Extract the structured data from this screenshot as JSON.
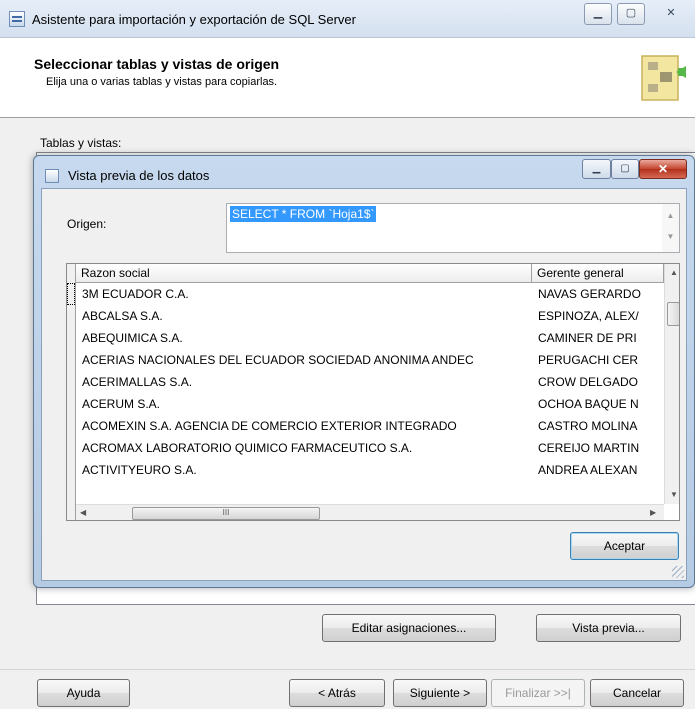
{
  "window": {
    "title": "Asistente para importación y exportación de SQL Server",
    "minimize_glyph": "▁",
    "maximize_glyph": "▢",
    "close_glyph": "✕"
  },
  "header": {
    "title": "Seleccionar tablas y vistas de origen",
    "subtitle": "Elija una o varias tablas y vistas para copiarlas."
  },
  "tables_label": "Tablas y vistas:",
  "preview_dialog": {
    "title": "Vista previa de los datos",
    "origin_label": "Origen:",
    "sql": "SELECT * FROM `Hoja1$`",
    "columns": [
      "Razon social",
      "Gerente general"
    ],
    "rows": [
      [
        "3M ECUADOR C.A.",
        "NAVAS GERARDO"
      ],
      [
        "ABCALSA S.A.",
        "ESPINOZA, ALEX/"
      ],
      [
        "ABEQUIMICA S.A.",
        "CAMINER DE PRI"
      ],
      [
        "ACERIAS NACIONALES DEL ECUADOR SOCIEDAD ANONIMA ANDEC",
        "PERUGACHI CER"
      ],
      [
        "ACERIMALLAS S.A.",
        "CROW DELGADO"
      ],
      [
        "ACERUM S.A.",
        "OCHOA BAQUE N"
      ],
      [
        "ACOMEXIN S.A. AGENCIA DE COMERCIO EXTERIOR INTEGRADO",
        "CASTRO MOLINA"
      ],
      [
        "ACROMAX LABORATORIO QUIMICO FARMACEUTICO S.A.",
        "CEREIJO MARTIN"
      ],
      [
        "ACTIVITYEURO S.A.",
        "ANDREA ALEXAN"
      ]
    ],
    "hscroll_grip": "III",
    "accept_label": "Aceptar"
  },
  "buttons": {
    "edit_mappings": "Editar asignaciones...",
    "preview": "Vista previa...",
    "help": "Ayuda",
    "back": "< Atrás",
    "next": "Siguiente >",
    "finish": "Finalizar >>|",
    "cancel": "Cancelar"
  }
}
